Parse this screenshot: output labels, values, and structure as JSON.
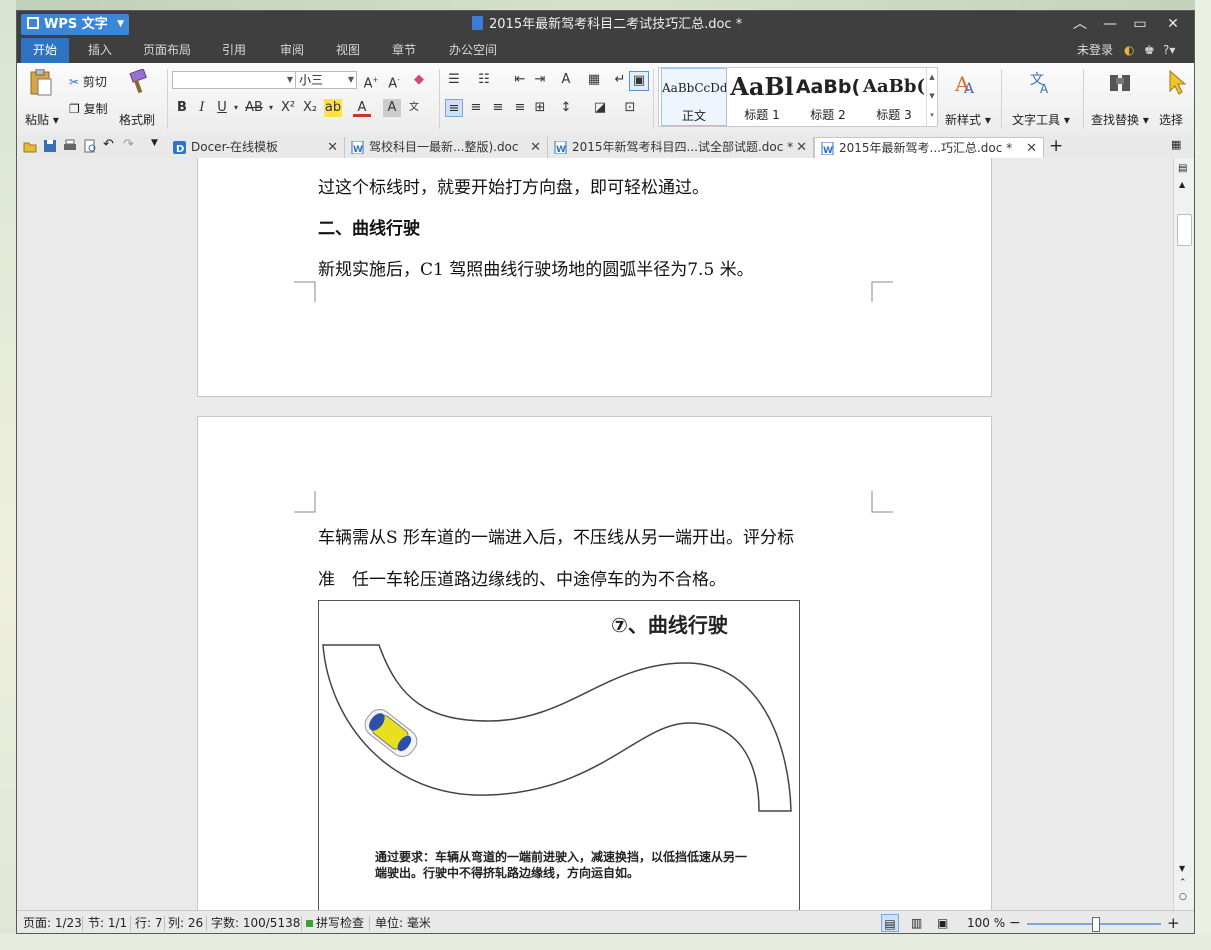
{
  "app": {
    "name": "WPS 文字",
    "document_title": "2015年最新驾考科目二考试技巧汇总.doc *"
  },
  "ribbon_tabs": [
    "开始",
    "插入",
    "页面布局",
    "引用",
    "审阅",
    "视图",
    "章节",
    "办公空间"
  ],
  "account": {
    "login": "未登录"
  },
  "toolbar": {
    "paste": "粘贴",
    "cut": "剪切",
    "copy": "复制",
    "format_painter": "格式刷",
    "font_name": "",
    "font_size": "小三",
    "styles": [
      {
        "sample": "AaBbCcDd",
        "name": "正文"
      },
      {
        "sample": "AaBl",
        "name": "标题 1"
      },
      {
        "sample": "AaBb(",
        "name": "标题 2"
      },
      {
        "sample": "AaBb(",
        "name": "标题 3"
      }
    ],
    "new_style": "新样式",
    "text_tools": "文字工具",
    "find_replace": "查找替换",
    "select": "选择"
  },
  "doc_tabs": [
    {
      "label": "Docer-在线模板"
    },
    {
      "label": "驾校科目一最新...整版).doc"
    },
    {
      "label": "2015年新驾考科目四...试全部试题.doc *"
    },
    {
      "label": "2015年最新驾考...巧汇总.doc *"
    }
  ],
  "document": {
    "page1": {
      "line1": "过这个标线时，就要开始打方向盘，即可轻松通过。",
      "heading": "二、曲线行驶",
      "line2": "新规实施后，C1 驾照曲线行驶场地的圆弧半径为7.5 米。"
    },
    "page2": {
      "line1": "车辆需从S 形车道的一端进入后，不压线从另一端开出。评分标",
      "line2": "准　任一车轮压道路边缘线的、中途停车的为不合格。",
      "figure_title": "⑦、曲线行驶",
      "figure_caption": "通过要求：车辆从弯道的一端前进驶入，减速换挡，以低挡低速从另一端驶出。行驶中不得挤轧路边缘线，方向运自如。"
    }
  },
  "status_bar": {
    "page": "页面: 1/23",
    "section": "节: 1/1",
    "row": "行: 7",
    "col": "列: 26",
    "word_count": "字数: 100/5138",
    "spell_check": "拼写检查",
    "unit": "单位: 毫米",
    "zoom": "100 %"
  },
  "colors": {
    "accent": "#2f73c4",
    "titlebar": "#3f3f3f",
    "car": "#e8e01e"
  }
}
